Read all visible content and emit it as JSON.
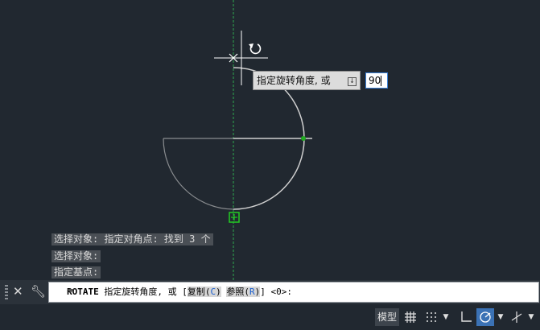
{
  "history": [
    "选择对象: 指定对角点: 找到 3 个",
    "选择对象:",
    "指定基点:"
  ],
  "tooltip": {
    "prompt": "指定旋转角度, 或",
    "icon": "down-arrow-icon"
  },
  "dynamic_input": {
    "value": "90"
  },
  "command_line": {
    "command": "ROTATE",
    "prompt": " 指定旋转角度, 或 [",
    "option1_label": "复制(",
    "option1_key": "C",
    "option1_close": ")",
    "option2_label": "参照(",
    "option2_key": "R",
    "option2_close": ")",
    "default": "] <0>:"
  },
  "statusbar": {
    "model_label": "模型"
  },
  "colors": {
    "background": "#212830",
    "geometry": "#c8c8c8",
    "axis": "#2fa84f",
    "snap": "#22aa22",
    "accent": "#3b72b5"
  }
}
